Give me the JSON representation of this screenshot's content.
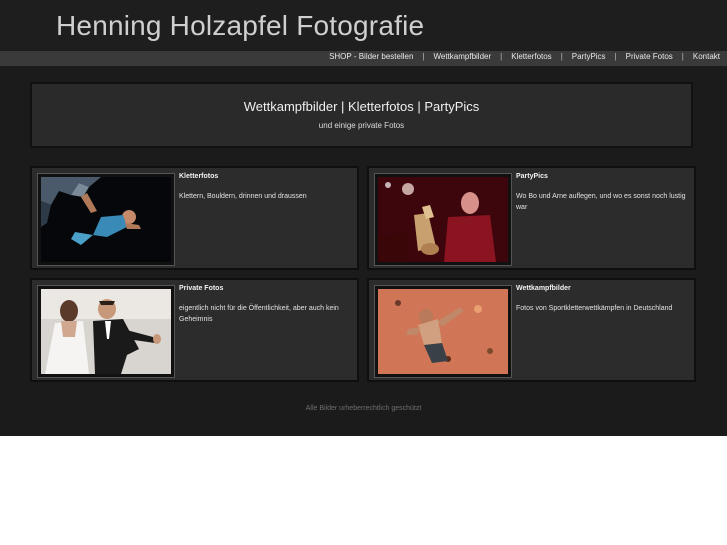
{
  "site": {
    "title": "Henning Holzapfel Fotografie"
  },
  "nav": {
    "items": [
      "SHOP - Bilder bestellen",
      "Wettkampfbilder",
      "Kletterfotos",
      "PartyPics",
      "Private Fotos",
      "Kontakt"
    ],
    "separator": "|"
  },
  "hero": {
    "title": "Wettkampfbilder | Kletterfotos | PartyPics",
    "subtitle": "und einige private Fotos"
  },
  "cards": [
    {
      "title": "Kletterfotos",
      "desc": "Klettern, Bouldern, drinnen und draussen",
      "image": "bouldering-photo"
    },
    {
      "title": "PartyPics",
      "desc": "Wo Bo und Arne auflegen, und wo es sonst noch lustig war",
      "image": "saxophone-photo"
    },
    {
      "title": "Private Fotos",
      "desc": "eigentlich nicht für die Öffentlichkeit, aber auch kein Geheimnis",
      "image": "wedding-dance-photo"
    },
    {
      "title": "Wettkampfbilder",
      "desc": "Fotos von Sportkletterwettkämpfen in Deutschland",
      "image": "climbing-wall-photo"
    }
  ],
  "footer": {
    "text": "Alle Bilder urheberrechtlich geschützt"
  },
  "colors": {
    "background": "#1b1b1b",
    "navbar": "#3a3a3a",
    "card": "#2c2c2c"
  }
}
